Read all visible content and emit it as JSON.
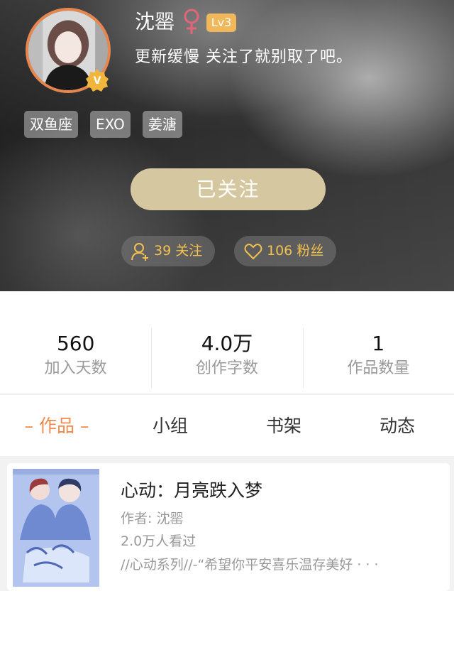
{
  "profile": {
    "username": "沈罂",
    "gender_icon": "female-symbol-icon",
    "gender_color": "#e2667a",
    "level": "Lv3",
    "bio": "更新缓慢 关注了就别取了吧。",
    "verified_icon": "verified-v-badge-icon",
    "tags": [
      "双鱼座",
      "EXO",
      "姜溏"
    ],
    "follow_button_label": "已关注",
    "following_label": "39 关注",
    "fans_label": "106 粉丝",
    "accent_color": "#f3c14f"
  },
  "stats": [
    {
      "value": "560",
      "label": "加入天数"
    },
    {
      "value": "4.0万",
      "label": "创作字数"
    },
    {
      "value": "1",
      "label": "作品数量"
    }
  ],
  "tabs": [
    {
      "label": "– 作品 –",
      "active": true
    },
    {
      "label": "小组",
      "active": false
    },
    {
      "label": "书架",
      "active": false
    },
    {
      "label": "动态",
      "active": false
    }
  ],
  "tab_active_color": "#ef8a4c",
  "books": [
    {
      "title": "心动：月亮跌入梦",
      "author": "作者: 沈罂",
      "views": "2.0万人看过",
      "description": "//心动系列//-“希望你平安喜乐温存美好 · · ·"
    }
  ]
}
